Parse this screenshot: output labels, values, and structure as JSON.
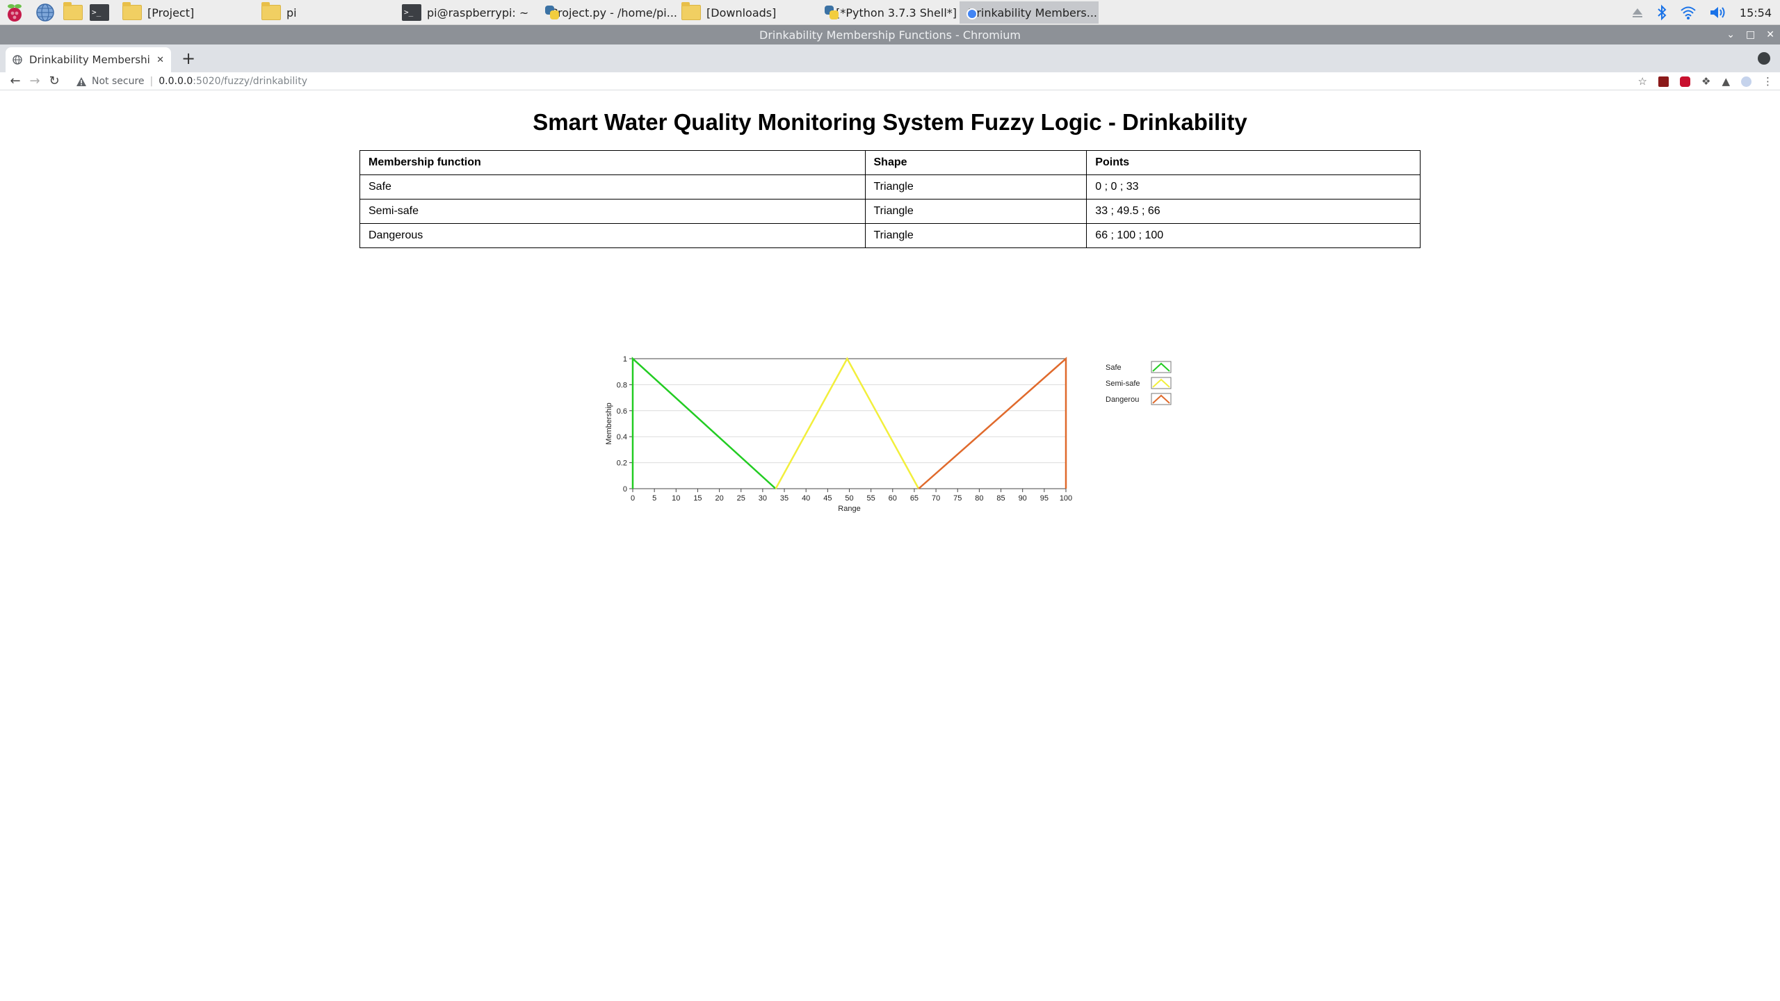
{
  "taskbar": {
    "windows": [
      {
        "label": "[Project]",
        "icon": "folder-icon"
      },
      {
        "label": "pi",
        "icon": "folder-icon"
      },
      {
        "label": "pi@raspberrypi: ~",
        "icon": "terminal-icon"
      },
      {
        "label": "Project.py - /home/pi...",
        "icon": "python-icon"
      },
      {
        "label": "[Downloads]",
        "icon": "folder-icon"
      },
      {
        "label": "[*Python 3.7.3 Shell*]",
        "icon": "python-icon"
      },
      {
        "label": "Drinkability Members...",
        "icon": "chromium-icon"
      }
    ],
    "clock": "15:54"
  },
  "window": {
    "title": "Drinkability Membership Functions - Chromium"
  },
  "browser": {
    "tab_title": "Drinkability Membership Functions",
    "security_label": "Not secure",
    "url_host": "0.0.0.0",
    "url_path": ":5020/fuzzy/drinkability"
  },
  "page": {
    "title": "Smart Water Quality Monitoring System Fuzzy Logic - Drinkability",
    "table": {
      "headers": [
        "Membership function",
        "Shape",
        "Points"
      ],
      "rows": [
        [
          "Safe",
          "Triangle",
          "0 ; 0 ; 33"
        ],
        [
          "Semi-safe",
          "Triangle",
          "33 ; 49.5 ; 66"
        ],
        [
          "Dangerous",
          "Triangle",
          "66 ; 100 ; 100"
        ]
      ]
    }
  },
  "chart_data": {
    "type": "line",
    "xlabel": "Range",
    "ylabel": "Membership",
    "xlim": [
      0,
      100
    ],
    "ylim": [
      0,
      1
    ],
    "xticks": [
      0,
      5,
      10,
      15,
      20,
      25,
      30,
      35,
      40,
      45,
      50,
      55,
      60,
      65,
      70,
      75,
      80,
      85,
      90,
      95,
      100
    ],
    "yticks": [
      0,
      0.2,
      0.4,
      0.6,
      0.8,
      1
    ],
    "grid": true,
    "legend_position": "right",
    "series": [
      {
        "name": "Safe",
        "color": "#22cc22",
        "x": [
          0,
          0,
          33
        ],
        "y": [
          0,
          1,
          0
        ]
      },
      {
        "name": "Semi-safe",
        "color": "#f2ef3c",
        "x": [
          33,
          49.5,
          66
        ],
        "y": [
          0,
          1,
          0
        ]
      },
      {
        "name": "Dangerou",
        "color": "#e06a2c",
        "x": [
          66,
          100,
          100
        ],
        "y": [
          0,
          1,
          0
        ]
      }
    ]
  }
}
